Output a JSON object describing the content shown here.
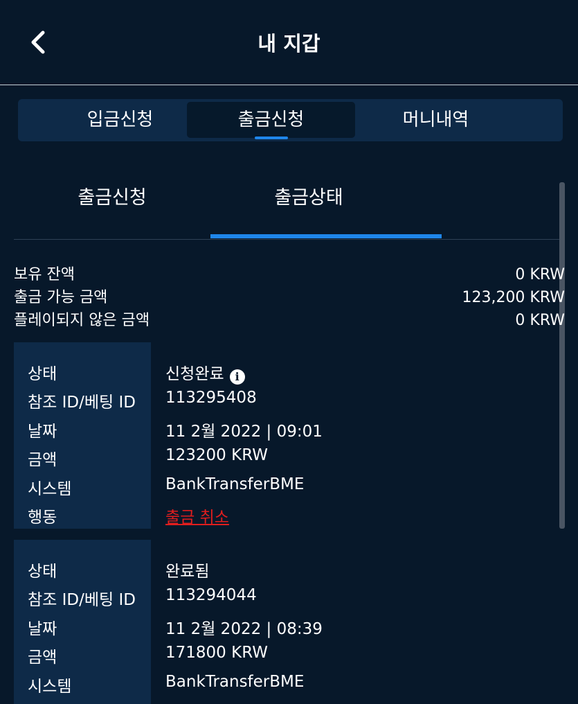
{
  "header": {
    "title": "내 지갑",
    "back_icon": "chevron-left-icon"
  },
  "main_tabs": [
    "입금신청",
    "출금신청",
    "머니내역"
  ],
  "sub_tabs": [
    "출금신청",
    "출금상태"
  ],
  "summary": [
    {
      "label": "보유 잔액",
      "value": "0 KRW"
    },
    {
      "label": "출금 가능 금액",
      "value": "123,200 KRW"
    },
    {
      "label": "플레이되지 않은 금액",
      "value": "0 KRW"
    }
  ],
  "labels": {
    "status": "상태",
    "ref": "참조 ID/베팅 ID",
    "date": "날짜",
    "amount": "금액",
    "system": "시스템",
    "action": "행동"
  },
  "transactions": [
    {
      "status": "신청완료",
      "ref": "113295408",
      "date": "11 2월 2022 | 09:01",
      "amount": "123200 KRW",
      "system": "BankTransferBME",
      "action": "출금 취소"
    },
    {
      "status": "완료됨",
      "ref": "113294044",
      "date": "11 2월 2022 | 08:39",
      "amount": "171800 KRW",
      "system": "BankTransferBME"
    }
  ],
  "colors": {
    "background": "#07182a",
    "panel": "#0e2a48",
    "accent": "#1f86ea",
    "cancel": "#e01e1e"
  }
}
